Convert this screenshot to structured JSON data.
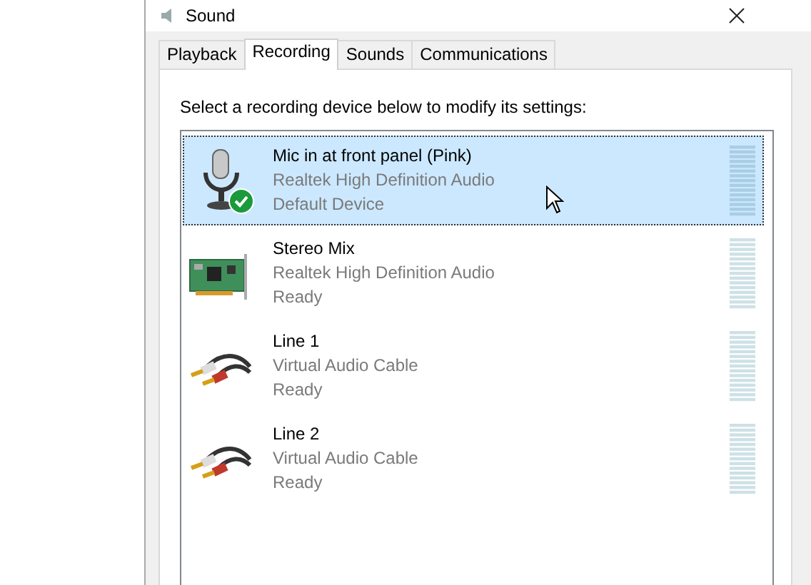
{
  "window": {
    "title": "Sound"
  },
  "tabs": [
    {
      "label": "Playback",
      "selected": false
    },
    {
      "label": "Recording",
      "selected": true
    },
    {
      "label": "Sounds",
      "selected": false
    },
    {
      "label": "Communications",
      "selected": false
    }
  ],
  "instruction": "Select a recording device below to modify its settings:",
  "devices": [
    {
      "kind": "mic",
      "name": "Mic in at front panel (Pink)",
      "driver": "Realtek High Definition Audio",
      "status": "Default Device",
      "selected": true,
      "default": true
    },
    {
      "kind": "card",
      "name": "Stereo Mix",
      "driver": "Realtek High Definition Audio",
      "status": "Ready",
      "selected": false,
      "default": false
    },
    {
      "kind": "cable",
      "name": "Line 1",
      "driver": "Virtual Audio Cable",
      "status": "Ready",
      "selected": false,
      "default": false
    },
    {
      "kind": "cable",
      "name": "Line 2",
      "driver": "Virtual Audio Cable",
      "status": "Ready",
      "selected": false,
      "default": false
    }
  ]
}
